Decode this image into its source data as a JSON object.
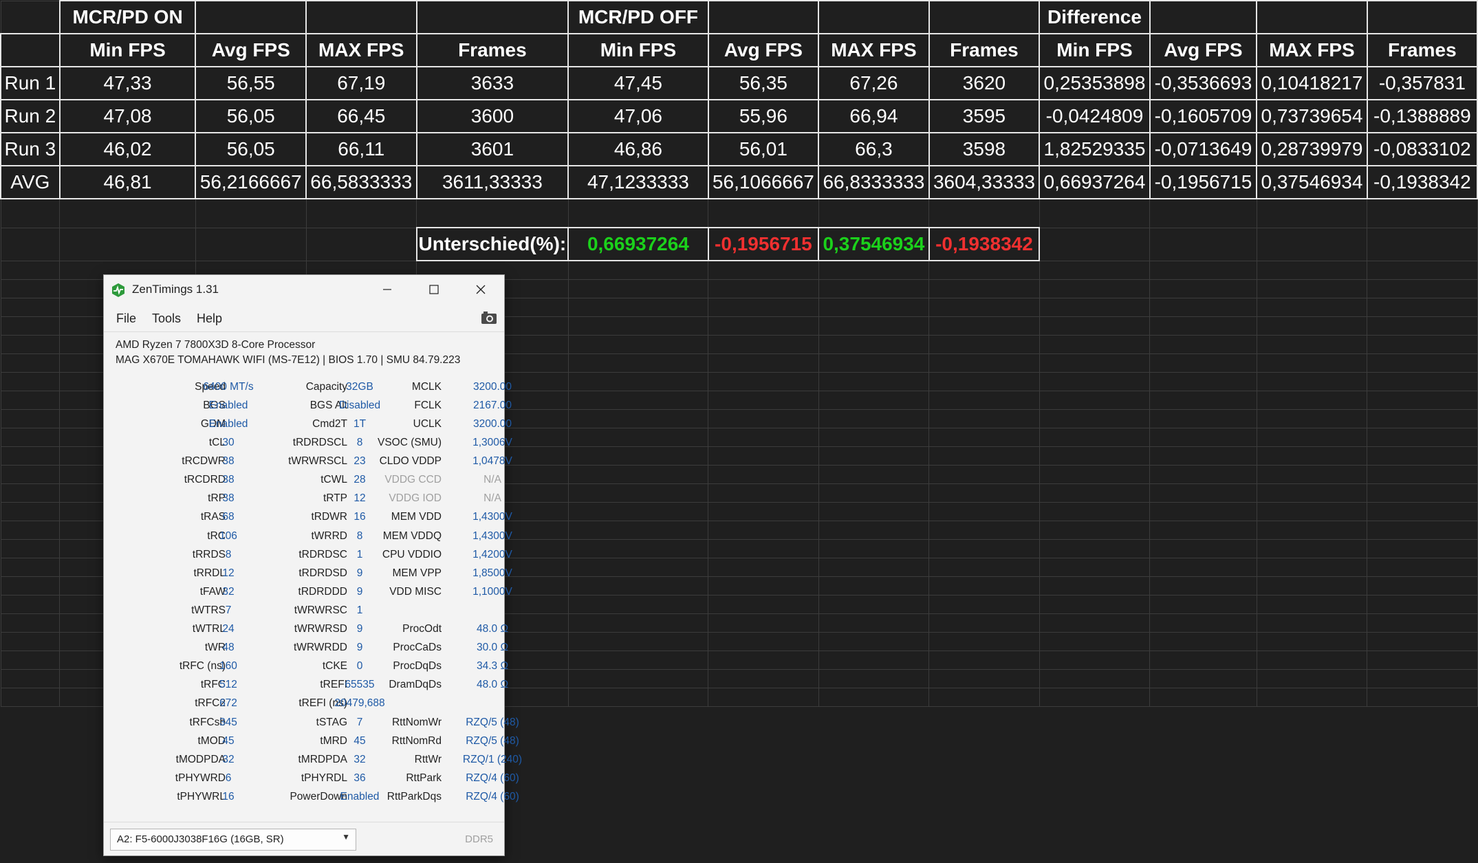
{
  "sheet": {
    "group_headers": [
      "MCR/PD ON",
      "MCR/PD OFF",
      "Difference"
    ],
    "col_headers": [
      "Min FPS",
      "Avg FPS",
      "MAX FPS",
      "Frames",
      "Min FPS",
      "Avg FPS",
      "MAX FPS",
      "Frames",
      "Min FPS",
      "Avg FPS",
      "MAX FPS",
      "Frames"
    ],
    "rows": [
      {
        "label": "Run 1",
        "cells": [
          "47,33",
          "56,55",
          "67,19",
          "3633",
          "47,45",
          "56,35",
          "67,26",
          "3620",
          "0,25353898",
          "-0,3536693",
          "0,10418217",
          "-0,357831"
        ]
      },
      {
        "label": "Run 2",
        "cells": [
          "47,08",
          "56,05",
          "66,45",
          "3600",
          "47,06",
          "55,96",
          "66,94",
          "3595",
          "-0,0424809",
          "-0,1605709",
          "0,73739654",
          "-0,1388889"
        ]
      },
      {
        "label": "Run 3",
        "cells": [
          "46,02",
          "56,05",
          "66,11",
          "3601",
          "46,86",
          "56,01",
          "66,3",
          "3598",
          "1,82529335",
          "-0,0713649",
          "0,28739979",
          "-0,0833102"
        ]
      },
      {
        "label": "AVG",
        "cells": [
          "46,81",
          "56,2166667",
          "66,5833333",
          "3611,33333",
          "47,1233333",
          "56,1066667",
          "66,8333333",
          "3604,33333",
          "0,66937264",
          "-0,1956715",
          "0,37546934",
          "-0,1938342"
        ]
      }
    ],
    "pct_label": "Unterschied(%):",
    "pct_values": [
      {
        "value": "0,66937264",
        "color": "#1bd11b"
      },
      {
        "value": "-0,1956715",
        "color": "#f03030"
      },
      {
        "value": "0,37546934",
        "color": "#1bd11b"
      },
      {
        "value": "-0,1938342",
        "color": "#f03030"
      }
    ]
  },
  "zentimings": {
    "title": "ZenTimings 1.31",
    "menu": [
      "File",
      "Tools",
      "Help"
    ],
    "cpu": "AMD Ryzen 7 7800X3D 8-Core Processor",
    "board": "MAG X670E TOMAHAWK WIFI (MS-7E12) | BIOS 1.70 | SMU 84.79.223",
    "top": [
      [
        {
          "l": "Speed",
          "v": "6400 MT/s"
        },
        {
          "l": "Capacity",
          "v": "32GB"
        },
        {
          "l": "MCLK",
          "v": "3200.00"
        }
      ],
      [
        {
          "l": "BGS",
          "v": "Enabled"
        },
        {
          "l": "BGS Alt",
          "v": "Disabled"
        },
        {
          "l": "FCLK",
          "v": "2167.00"
        }
      ],
      [
        {
          "l": "GDM",
          "v": "Enabled"
        },
        {
          "l": "Cmd2T",
          "v": "1T"
        },
        {
          "l": "UCLK",
          "v": "3200.00"
        }
      ]
    ],
    "timings": [
      [
        {
          "l": "tCL",
          "v": "30"
        },
        {
          "l": "tRDRDSCL",
          "v": "8"
        },
        {
          "l": "VSOC (SMU)",
          "v": "1,3006V"
        }
      ],
      [
        {
          "l": "tRCDWR",
          "v": "38"
        },
        {
          "l": "tWRWRSCL",
          "v": "23"
        },
        {
          "l": "CLDO VDDP",
          "v": "1,0478V"
        }
      ],
      [
        {
          "l": "tRCDRD",
          "v": "38"
        },
        {
          "l": "tCWL",
          "v": "28"
        },
        {
          "l": "VDDG CCD",
          "v": "N/A",
          "dim": true
        }
      ],
      [
        {
          "l": "tRP",
          "v": "38"
        },
        {
          "l": "tRTP",
          "v": "12"
        },
        {
          "l": "VDDG IOD",
          "v": "N/A",
          "dim": true
        }
      ],
      [
        {
          "l": "tRAS",
          "v": "68"
        },
        {
          "l": "tRDWR",
          "v": "16"
        },
        {
          "l": "MEM VDD",
          "v": "1,4300V"
        }
      ],
      [
        {
          "l": "tRC",
          "v": "106"
        },
        {
          "l": "tWRRD",
          "v": "8"
        },
        {
          "l": "MEM VDDQ",
          "v": "1,4300V"
        }
      ],
      [
        {
          "l": "tRRDS",
          "v": "8"
        },
        {
          "l": "tRDRDSC",
          "v": "1"
        },
        {
          "l": "CPU VDDIO",
          "v": "1,4200V"
        }
      ],
      [
        {
          "l": "tRRDL",
          "v": "12"
        },
        {
          "l": "tRDRDSD",
          "v": "9"
        },
        {
          "l": "MEM VPP",
          "v": "1,8500V"
        }
      ],
      [
        {
          "l": "tFAW",
          "v": "32"
        },
        {
          "l": "tRDRDDD",
          "v": "9"
        },
        {
          "l": "VDD MISC",
          "v": "1,1000V"
        }
      ],
      [
        {
          "l": "tWTRS",
          "v": "7"
        },
        {
          "l": "tWRWRSC",
          "v": "1"
        },
        {
          "l": "",
          "v": ""
        }
      ],
      [
        {
          "l": "tWTRL",
          "v": "24"
        },
        {
          "l": "tWRWRSD",
          "v": "9"
        },
        {
          "l": "ProcOdt",
          "v": "48.0 Ω"
        }
      ],
      [
        {
          "l": "tWR",
          "v": "48"
        },
        {
          "l": "tWRWRDD",
          "v": "9"
        },
        {
          "l": "ProcCaDs",
          "v": "30.0 Ω"
        }
      ],
      [
        {
          "l": "tRFC (ns)",
          "v": "160"
        },
        {
          "l": "tCKE",
          "v": "0"
        },
        {
          "l": "ProcDqDs",
          "v": "34.3 Ω"
        }
      ],
      [
        {
          "l": "tRFC",
          "v": "512"
        },
        {
          "l": "tREFI",
          "v": "65535"
        },
        {
          "l": "DramDqDs",
          "v": "48.0 Ω"
        }
      ],
      [
        {
          "l": "tRFC2",
          "v": "672"
        },
        {
          "l": "tREFI (ns)",
          "v": "20479,688"
        },
        {
          "l": "",
          "v": ""
        }
      ],
      [
        {
          "l": "tRFCsb",
          "v": "345"
        },
        {
          "l": "tSTAG",
          "v": "7"
        },
        {
          "l": "RttNomWr",
          "v": "RZQ/5 (48)"
        }
      ],
      [
        {
          "l": "tMOD",
          "v": "45"
        },
        {
          "l": "tMRD",
          "v": "45"
        },
        {
          "l": "RttNomRd",
          "v": "RZQ/5 (48)"
        }
      ],
      [
        {
          "l": "tMODPDA",
          "v": "32"
        },
        {
          "l": "tMRDPDA",
          "v": "32"
        },
        {
          "l": "RttWr",
          "v": "RZQ/1 (240)"
        }
      ],
      [
        {
          "l": "tPHYWRD",
          "v": "6"
        },
        {
          "l": "tPHYRDL",
          "v": "36"
        },
        {
          "l": "RttPark",
          "v": "RZQ/4 (60)"
        }
      ],
      [
        {
          "l": "tPHYWRL",
          "v": "16"
        },
        {
          "l": "PowerDown",
          "v": "Enabled"
        },
        {
          "l": "RttParkDqs",
          "v": "RZQ/4 (60)"
        }
      ]
    ],
    "dimm_select": "A2: F5-6000J3038F16G (16GB, SR)",
    "mem_type": "DDR5",
    "icons": [
      "zentimings-app-icon",
      "minimize-icon",
      "maximize-icon",
      "close-icon",
      "camera-icon",
      "dropdown-arrow-icon"
    ]
  }
}
